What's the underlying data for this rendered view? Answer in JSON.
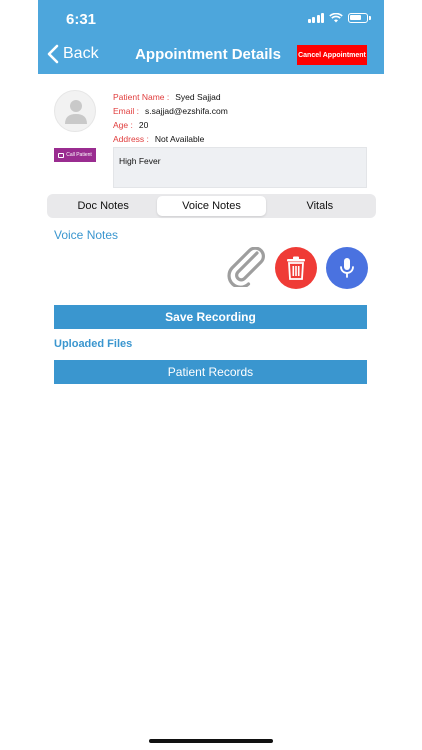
{
  "status_bar": {
    "time": "6:31"
  },
  "header": {
    "back_label": "Back",
    "title": "Appointment Details",
    "cancel_label": "Cancel Appointment",
    "background_color": "#4da6dc"
  },
  "patient": {
    "call_badge_label": "Call Patient",
    "fields": [
      {
        "label": "Patient Name :",
        "value": "Syed Sajjad"
      },
      {
        "label": "Email :",
        "value": "s.sajjad@ezshifa.com"
      },
      {
        "label": "Age :",
        "value": "20"
      },
      {
        "label": "Address :",
        "value": "Not Available"
      }
    ],
    "complaint": "High Fever"
  },
  "tabs": [
    {
      "label": "Doc Notes",
      "active": false
    },
    {
      "label": "Voice Notes",
      "active": true
    },
    {
      "label": "Vitals",
      "active": false
    }
  ],
  "voice_notes": {
    "title": "Voice Notes",
    "icons": [
      "paperclip-icon",
      "trash-icon",
      "microphone-icon"
    ],
    "save_label": "Save Recording"
  },
  "uploaded_files": {
    "title": "Uploaded Files",
    "records_label": "Patient Records"
  },
  "colors": {
    "accent": "#3a96cf",
    "danger": "#ef3b36",
    "mic": "#4a72e0",
    "label_red": "#e03c3c",
    "badge_purple": "#9a2c90"
  }
}
